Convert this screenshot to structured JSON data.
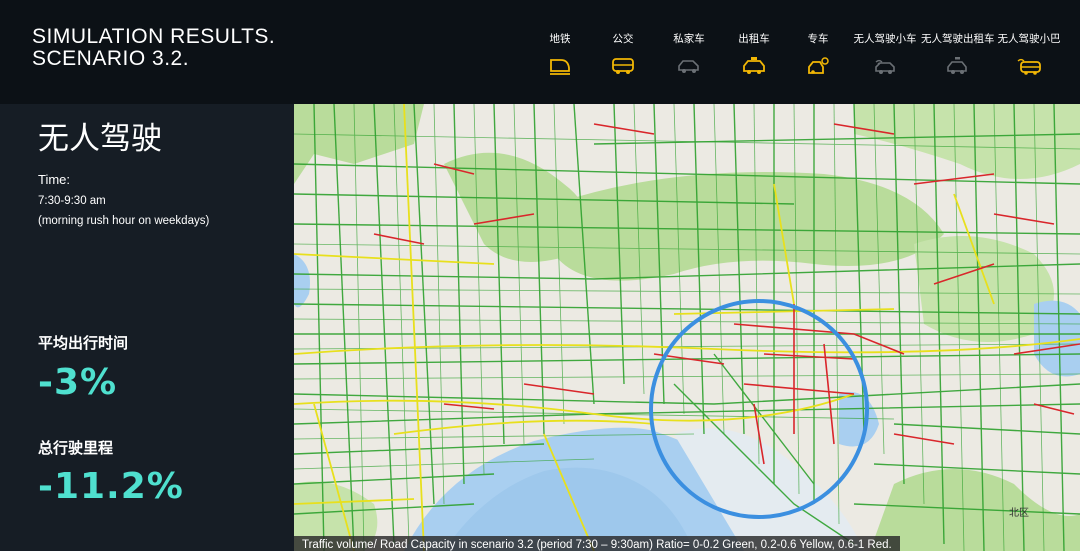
{
  "header": {
    "title_line1": "SIMULATION RESULTS.",
    "title_line2": "SCENARIO 3.2."
  },
  "modes": [
    {
      "label": "地铁",
      "icon": "subway-icon",
      "color": "#f2b705"
    },
    {
      "label": "公交",
      "icon": "bus-icon",
      "color": "#f2b705"
    },
    {
      "label": "私家车",
      "icon": "private-car-icon",
      "color": "#6b7075"
    },
    {
      "label": "出租车",
      "icon": "taxi-icon",
      "color": "#f2b705"
    },
    {
      "label": "专车",
      "icon": "ride-hailing-icon",
      "color": "#f2b705"
    },
    {
      "label": "无人驾驶小车",
      "icon": "autonomous-car-icon",
      "color": "#6b7075"
    },
    {
      "label": "无人驾驶出租车",
      "icon": "autonomous-taxi-icon",
      "color": "#6b7075"
    },
    {
      "label": "无人驾驶小巴",
      "icon": "autonomous-minibus-icon",
      "color": "#f2b705"
    }
  ],
  "sidebar": {
    "mode_title": "无人驾驶",
    "time_label": "Time:",
    "time_range": "7:30-9:30 am",
    "time_note": "(morning rush hour on weekdays)",
    "metric1_label": "平均出行时间",
    "metric1_value": "-3%",
    "metric2_label": "总行驶里程",
    "metric2_value": "-11.2%",
    "accent_color": "#4fe0cf"
  },
  "map": {
    "caption": "Traffic volume/ Road Capacity in scenario 3.2 (period 7:30 – 9:30am) Ratio= 0-0.2 Green, 0.2-0.6 Yellow, 0.6-1 Red.",
    "legend_colors": {
      "low": "#2ea12e",
      "medium": "#e8e01c",
      "high": "#d9262b"
    },
    "highlight_circle_color": "#3b8fe0",
    "district_label": "北区"
  }
}
